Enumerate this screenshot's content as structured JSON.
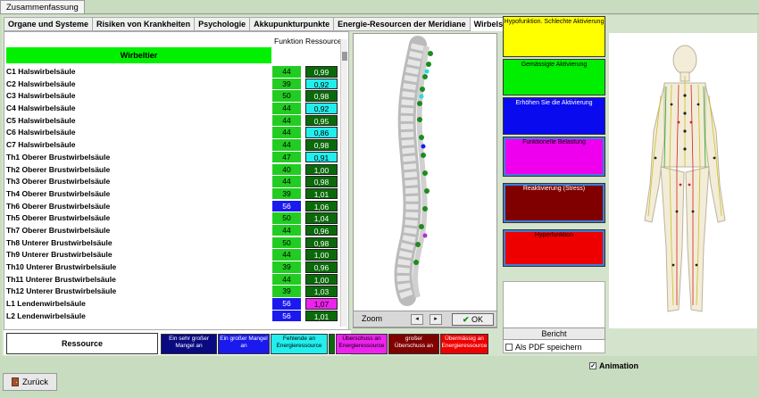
{
  "window": {
    "title": "Zusammenfassung"
  },
  "tabs": [
    {
      "label": "Organe und Systeme"
    },
    {
      "label": "Risiken von Krankheiten"
    },
    {
      "label": "Psychologie"
    },
    {
      "label": "Akkupunkturpunkte"
    },
    {
      "label": "Energie-Resourcen der Meridiane"
    },
    {
      "label": "Wirbelsäule",
      "active": true
    }
  ],
  "table": {
    "headers": {
      "funktion": "Funktion",
      "ressource": "Ressource"
    },
    "group_title": "Wirbeltier",
    "rows": [
      {
        "name": "C1 Halswirbelsäule",
        "funktion": "44",
        "ressource": "0,99",
        "f_color": "#22cc22",
        "r_color": "#0a6a0a",
        "r_text": "#ffffff"
      },
      {
        "name": "C2 Halswirbelsäule",
        "funktion": "39",
        "ressource": "0,92",
        "f_color": "#22cc22",
        "r_color": "#22eeee",
        "r_text": "#000000"
      },
      {
        "name": "C3 Halswirbelsäule",
        "funktion": "50",
        "ressource": "0,98",
        "f_color": "#22cc22",
        "r_color": "#0a6a0a",
        "r_text": "#ffffff"
      },
      {
        "name": "C4 Halswirbelsäule",
        "funktion": "44",
        "ressource": "0,92",
        "f_color": "#22cc22",
        "r_color": "#22eeee",
        "r_text": "#000000"
      },
      {
        "name": "C5 Halswirbelsäule",
        "funktion": "44",
        "ressource": "0,95",
        "f_color": "#22cc22",
        "r_color": "#0a6a0a",
        "r_text": "#ffffff"
      },
      {
        "name": "C6 Halswirbelsäule",
        "funktion": "44",
        "ressource": "0,86",
        "f_color": "#22cc22",
        "r_color": "#22eeee",
        "r_text": "#000000"
      },
      {
        "name": "C7 Halswirbelsäule",
        "funktion": "44",
        "ressource": "0,98",
        "f_color": "#22cc22",
        "r_color": "#0a6a0a",
        "r_text": "#ffffff"
      },
      {
        "name": "Th1 Oberer Brustwirbelsäule",
        "funktion": "47",
        "ressource": "0,91",
        "f_color": "#22cc22",
        "r_color": "#22eeee",
        "r_text": "#000000"
      },
      {
        "name": "Th2 Oberer Brustwirbelsäule",
        "funktion": "40",
        "ressource": "1,00",
        "f_color": "#22cc22",
        "r_color": "#0a6a0a",
        "r_text": "#ffffff"
      },
      {
        "name": "Th3 Oberer Brustwirbelsäule",
        "funktion": "44",
        "ressource": "0,98",
        "f_color": "#22cc22",
        "r_color": "#0a6a0a",
        "r_text": "#ffffff"
      },
      {
        "name": "Th4 Oberer Brustwirbelsäule",
        "funktion": "39",
        "ressource": "1,01",
        "f_color": "#22cc22",
        "r_color": "#0a6a0a",
        "r_text": "#ffffff"
      },
      {
        "name": "Th6 Oberer Brustwirbelsäule",
        "funktion": "56",
        "ressource": "1,06",
        "f_color": "#1a1aee",
        "r_color": "#0a6a0a",
        "r_text": "#ffffff",
        "f_text": "#ffffff"
      },
      {
        "name": "Th5 Oberer Brustwirbelsäule",
        "funktion": "50",
        "ressource": "1,04",
        "f_color": "#22cc22",
        "r_color": "#0a6a0a",
        "r_text": "#ffffff"
      },
      {
        "name": "Th7 Oberer Brustwirbelsäule",
        "funktion": "44",
        "ressource": "0,96",
        "f_color": "#22cc22",
        "r_color": "#0a6a0a",
        "r_text": "#ffffff"
      },
      {
        "name": "Th8 Unterer Brustwirbelsäule",
        "funktion": "50",
        "ressource": "0,98",
        "f_color": "#22cc22",
        "r_color": "#0a6a0a",
        "r_text": "#ffffff"
      },
      {
        "name": "Th9 Unterer Brustwirbelsäule",
        "funktion": "44",
        "ressource": "1,00",
        "f_color": "#22cc22",
        "r_color": "#0a6a0a",
        "r_text": "#ffffff"
      },
      {
        "name": "Th10 Unterer Brustwirbelsäule",
        "funktion": "39",
        "ressource": "0,96",
        "f_color": "#22cc22",
        "r_color": "#0a6a0a",
        "r_text": "#ffffff"
      },
      {
        "name": "Th11 Unterer Brustwirbelsäule",
        "funktion": "44",
        "ressource": "1,00",
        "f_color": "#22cc22",
        "r_color": "#0a6a0a",
        "r_text": "#ffffff"
      },
      {
        "name": "Th12 Unterer Brustwirbelsäule",
        "funktion": "39",
        "ressource": "1,03",
        "f_color": "#22cc22",
        "r_color": "#0a6a0a",
        "r_text": "#ffffff"
      },
      {
        "name": "L1 Lendenwirbelsäule",
        "funktion": "56",
        "ressource": "1,07",
        "f_color": "#1a1aee",
        "r_color": "#ee22ee",
        "r_text": "#000000",
        "f_text": "#ffffff"
      },
      {
        "name": "L2 Lendenwirbelsäule",
        "funktion": "56",
        "ressource": "1,01",
        "f_color": "#1a1aee",
        "r_color": "#0a6a0a",
        "r_text": "#ffffff",
        "f_text": "#ffffff"
      }
    ]
  },
  "legend": {
    "ressource_label": "Ressource",
    "items": [
      {
        "label": "Ein sehr großer Mangel an",
        "color": "#0a0a80",
        "text": "#ffffff"
      },
      {
        "label": "Ein großer Mangel an",
        "color": "#1a1aee",
        "text": "#ffffff"
      },
      {
        "label": "Fehlende an Energieressource",
        "color": "#22eeee",
        "text": "#000000"
      },
      {
        "label": "",
        "color": "#0a6a0a",
        "text": "#ffffff"
      },
      {
        "label": "Überschuss an Energieressource",
        "color": "#ee22ee",
        "text": "#000000"
      },
      {
        "label": "großer Überschuss an",
        "color": "#800000",
        "text": "#ffffff"
      },
      {
        "label": "Übermässig an Energieressource",
        "color": "#ee0000",
        "text": "#ffffff"
      }
    ]
  },
  "spine_view": {
    "zoom_label": "Zoom",
    "prev_glyph": "◂",
    "next_glyph": "▸",
    "ok_label": "OK",
    "ok_icon": "checkmark-icon"
  },
  "categories": [
    {
      "label": "Hypofunktion. Schlechte Aktivierung",
      "color": "#ffff00",
      "text": "#000000"
    },
    {
      "label": "Gemässigte Aktivierung",
      "color": "#00ee00",
      "text": "#000000"
    },
    {
      "label": "Erhöhen Sie die Aktivierung",
      "color": "#0a0aee",
      "text": "#ffffff"
    },
    {
      "label": "Funktionelle Belastung",
      "color": "#ee00ee",
      "text": "#000000"
    },
    {
      "label": "Reaktivierung (Stress)",
      "color": "#800000",
      "text": "#ffffff"
    },
    {
      "label": "Hyperfunktion",
      "color": "#ee0000",
      "text": "#000000"
    }
  ],
  "report": {
    "button_label": "Bericht",
    "pdf_label": "Als PDF speichern"
  },
  "animation": {
    "label": "Animation",
    "checked": true
  },
  "footer": {
    "back_label": "Zurück"
  }
}
